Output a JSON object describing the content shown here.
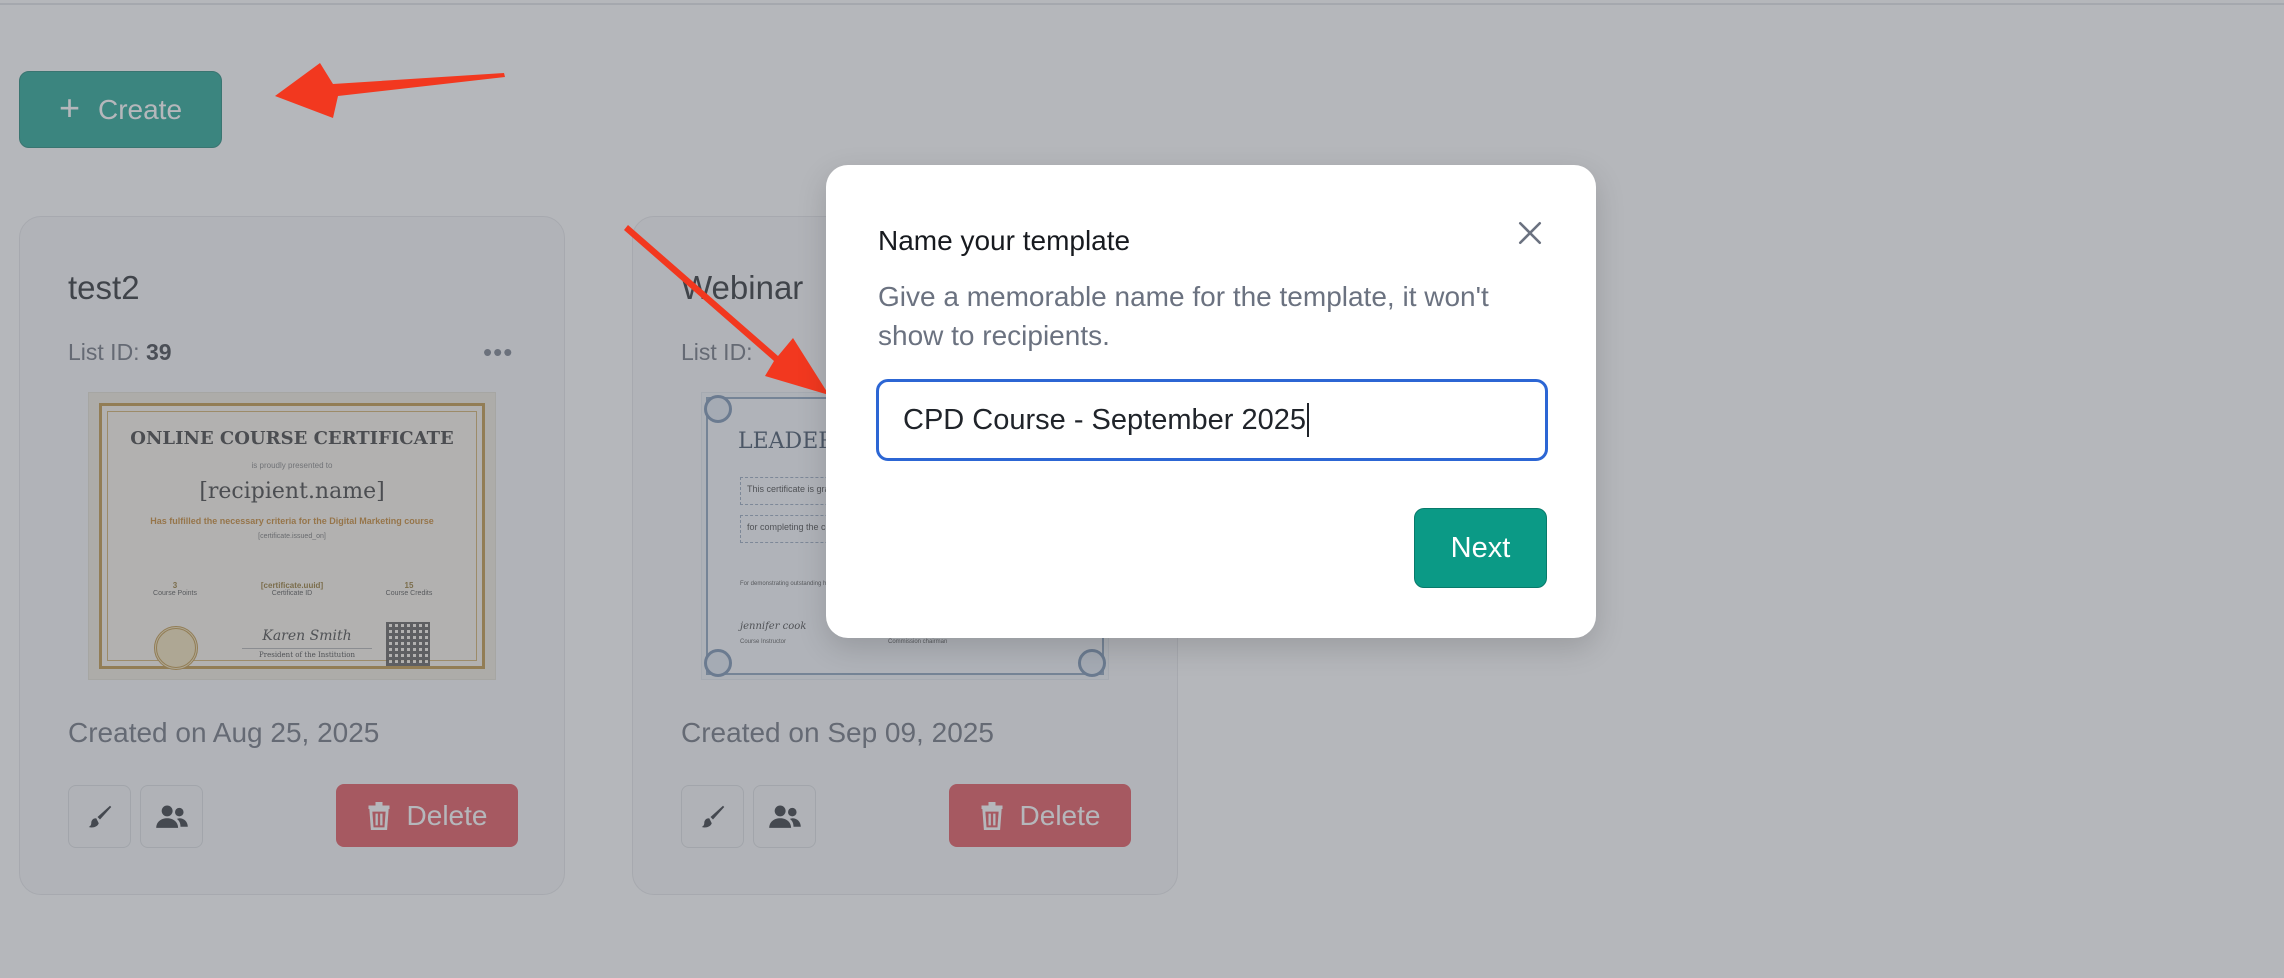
{
  "toolbar": {
    "create_label": "Create"
  },
  "cards": [
    {
      "title": "test2",
      "list_id_label": "List ID:",
      "list_id_value": "39",
      "created": "Created on Aug 25, 2025",
      "delete_label": "Delete",
      "certificate": {
        "heading": "ONLINE COURSE CERTIFICATE",
        "subheading": "is proudly presented to",
        "name": "[recipient.name]",
        "highlight": "Has fulfilled the necessary criteria for the Digital Marketing course",
        "issued": "[certificate.issued_on]",
        "stats": [
          {
            "value": "3",
            "label": "Course Points"
          },
          {
            "value": "[certificate.uuid]",
            "label": "Certificate ID"
          },
          {
            "value": "15",
            "label": "Course Credits"
          }
        ],
        "signature": "Karen Smith",
        "signature_role": "President of the Institution"
      }
    },
    {
      "title": "Webinar",
      "list_id_label": "List ID:",
      "created": "Created on Sep 09, 2025",
      "delete_label": "Delete",
      "certificate": {
        "heading": "LEADER",
        "line1": "This certificate is grante",
        "line2": "for completing the cour",
        "para": "For demonstrating outstanding  high level of professionalism an",
        "signature": "jennifer cook",
        "role1": "Course Instructor",
        "role2": "Commission chairman"
      }
    }
  ],
  "modal": {
    "title": "Name your template",
    "description": "Give a memorable name for the template, it won't show to recipients.",
    "input_value": "CPD Course - September 2025",
    "next_label": "Next"
  },
  "colors": {
    "accent": "#0b9a86",
    "danger": "#e0424a",
    "focus": "#2c66d4",
    "annotation_arrow": "#f2381f"
  }
}
